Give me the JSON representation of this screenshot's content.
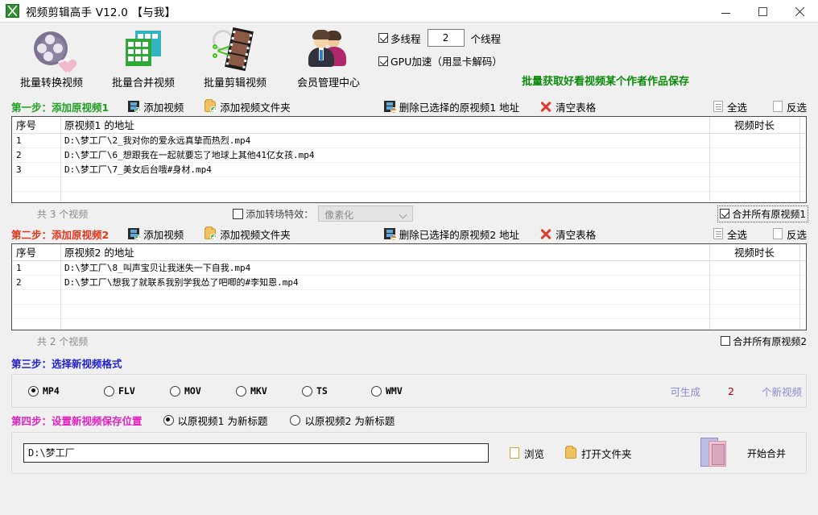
{
  "window": {
    "title": "视频剪辑高手 V12.0  【与我】",
    "minimize": "—",
    "maximize": "□",
    "close": "✕"
  },
  "toolbar": {
    "items": [
      {
        "label": "批量转换视频",
        "icon": "film-reel-icon"
      },
      {
        "label": "批量合并视频",
        "icon": "green-grid-icon"
      },
      {
        "label": "批量剪辑视频",
        "icon": "film-scissors-icon"
      },
      {
        "label": "会员管理中心",
        "icon": "members-icon"
      }
    ],
    "multithread_label": "多线程",
    "multithread_checked": true,
    "thread_count": "2",
    "thread_unit": "个线程",
    "gpu_label": "GPU加速（用显卡解码）",
    "gpu_checked": true,
    "promo": "批量获取好看视频某个作者作品保存"
  },
  "step1": {
    "title": "第一步：添加原视频1",
    "add_video": "添加视频",
    "add_folder": "添加视频文件夹",
    "delete_selected": "删除已选择的原视频1 地址",
    "clear_table": "清空表格",
    "select_all": "全选",
    "invert_select": "反选",
    "columns": [
      "序号",
      "原视频1 的地址",
      "视频时长"
    ],
    "rows": [
      {
        "idx": "1",
        "path": "D:\\梦工厂\\2_我对你的爱永远真挚而热烈.mp4",
        "duration": ""
      },
      {
        "idx": "2",
        "path": "D:\\梦工厂\\6_想跟我在一起就要忘了地球上其他41亿女孩.mp4",
        "duration": ""
      },
      {
        "idx": "3",
        "path": "D:\\梦工厂\\7_美女后台哦#身材.mp4",
        "duration": ""
      }
    ],
    "count_text": "共 3 个视频",
    "transition_label": "添加转场特效：",
    "transition_checked": false,
    "transition_value": "像素化",
    "merge_all_label": "合并所有原视频1",
    "merge_all_checked": true
  },
  "step2": {
    "title": "第二步：添加原视频2",
    "add_video": "添加视频",
    "add_folder": "添加视频文件夹",
    "delete_selected": "删除已选择的原视频2 地址",
    "clear_table": "清空表格",
    "select_all": "全选",
    "invert_select": "反选",
    "columns": [
      "序号",
      "原视频2 的地址",
      "视频时长"
    ],
    "rows": [
      {
        "idx": "1",
        "path": "D:\\梦工厂\\8_叫声宝贝让我迷失一下自我.mp4",
        "duration": ""
      },
      {
        "idx": "2",
        "path": "D:\\梦工厂\\想我了就联系我别学我怂了吧唧的#李知恩.mp4",
        "duration": ""
      }
    ],
    "count_text": "共 2 个视频",
    "merge_all_label": "合并所有原视频2",
    "merge_all_checked": false
  },
  "step3": {
    "title": "第三步：选择新视频格式",
    "formats": [
      {
        "label": "MP4",
        "selected": true
      },
      {
        "label": "FLV",
        "selected": false
      },
      {
        "label": "MOV",
        "selected": false
      },
      {
        "label": "MKV",
        "selected": false
      },
      {
        "label": "TS",
        "selected": false
      },
      {
        "label": "WMV",
        "selected": false
      }
    ],
    "gen_prefix": "可生成",
    "gen_count": "2",
    "gen_suffix": "个新视频"
  },
  "step4": {
    "title": "第四步：设置新视频保存位置",
    "title_opt1": "以原视频1 为新标题",
    "title_opt1_selected": true,
    "title_opt2": "以原视频2 为新标题",
    "title_opt2_selected": false,
    "save_path": "D:\\梦工厂",
    "browse": "浏览",
    "open_folder": "打开文件夹",
    "start_button": "开始合并"
  },
  "colors": {
    "step1": "#22a022",
    "step2": "#e0351b",
    "step3": "#2222cc",
    "step4": "#e020c0",
    "promo": "#0a8a0a",
    "gen_label": "#8a8ad0",
    "gen_count": "#c00000"
  }
}
